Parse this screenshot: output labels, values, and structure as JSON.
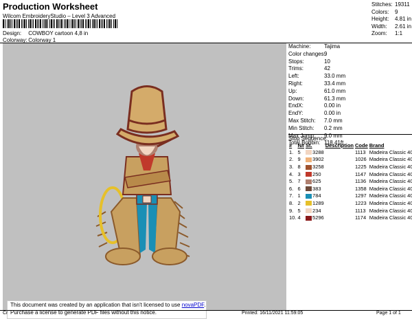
{
  "header": {
    "title": "Production Worksheet",
    "subtitle": "Wilcom EmbroideryStudio – Level 3 Advanced",
    "design_label": "Design:",
    "design_value": "COWBOY cartoon 4,8 in",
    "colorway_label": "Colorway:",
    "colorway_value": "Colorway 1"
  },
  "stats": [
    {
      "label": "Stitches:",
      "value": "19311"
    },
    {
      "label": "Colors:",
      "value": "9"
    },
    {
      "label": "Height:",
      "value": "4.81 in"
    },
    {
      "label": "Width:",
      "value": "2.61 in"
    },
    {
      "label": "Zoom:",
      "value": "1:1"
    }
  ],
  "machine": [
    {
      "label": "Machine:",
      "value": "Tajima"
    },
    {
      "label": "Color changes:",
      "value": "9"
    },
    {
      "label": "Stops:",
      "value": "10"
    },
    {
      "label": "Trims:",
      "value": "42"
    },
    {
      "label": "Left:",
      "value": "33.0 mm"
    },
    {
      "label": "Right:",
      "value": "33.4 mm"
    },
    {
      "label": "Up:",
      "value": "61.0 mm"
    },
    {
      "label": "Down:",
      "value": "61.3 mm"
    },
    {
      "label": "EndX:",
      "value": "0.00 in"
    },
    {
      "label": "EndY:",
      "value": "0.00 in"
    },
    {
      "label": "Max Stitch:",
      "value": "7.0 mm"
    },
    {
      "label": "Min Stitch:",
      "value": "0.2 mm"
    },
    {
      "label": "Max Jump:",
      "value": "9.0 mm"
    },
    {
      "label": "Total Bobbin:",
      "value": "118.41ft"
    }
  ],
  "stop_sequence": {
    "title": "Stop Sequence:",
    "columns": [
      "#",
      "N#",
      "St.",
      "Description",
      "Code",
      "Brand"
    ],
    "rows": [
      {
        "num": "1.",
        "n": "5",
        "color": "#f2d6c2",
        "st": "3288",
        "code": "1113",
        "brand": "Madeira Classic 40"
      },
      {
        "num": "2.",
        "n": "9",
        "color": "#f0b27a",
        "st": "3902",
        "code": "1026",
        "brand": "Madeira Classic 40"
      },
      {
        "num": "3.",
        "n": "8",
        "color": "#a0522d",
        "st": "3258",
        "code": "1225",
        "brand": "Madeira Classic 40"
      },
      {
        "num": "4.",
        "n": "3",
        "color": "#c0392b",
        "st": "250",
        "code": "1147",
        "brand": "Madeira Classic 40"
      },
      {
        "num": "5.",
        "n": "7",
        "color": "#b08070",
        "st": "625",
        "code": "1136",
        "brand": "Madeira Classic 40"
      },
      {
        "num": "6.",
        "n": "6",
        "color": "#6e4a3a",
        "st": "383",
        "code": "1358",
        "brand": "Madeira Classic 40"
      },
      {
        "num": "7.",
        "n": "1",
        "color": "#1a8fb5",
        "st": "784",
        "code": "1297",
        "brand": "Madeira Classic 40"
      },
      {
        "num": "8.",
        "n": "2",
        "color": "#e6c02a",
        "st": "1289",
        "code": "1223",
        "brand": "Madeira Classic 40"
      },
      {
        "num": "9.",
        "n": "5",
        "color": "#f2d6c2",
        "st": "234",
        "code": "1113",
        "brand": "Madeira Classic 40"
      },
      {
        "num": "10.",
        "n": "4",
        "color": "#8b1a1a",
        "st": "5296",
        "code": "1174",
        "brand": "Madeira Classic 40"
      }
    ]
  },
  "notice": {
    "line1": "This document was created by an application that isn't licensed to use",
    "link": "novaPDF",
    "line1_end": ".",
    "line2": "Purchase a license to generate PDF files without this notice."
  },
  "footer": {
    "left": "Cr",
    "printed": "Printed: 16/11/2021 11:59:05",
    "page": "Page 1 of 1"
  },
  "colors": {
    "preview_bg": "#c0c0c0",
    "hat": "#d4ab6a",
    "hat_outline": "#7a2e20",
    "chaps": "#c8a060",
    "fringe": "#8b5a2b",
    "jeans": "#1a8fb5",
    "rope": "#e6c02a"
  }
}
